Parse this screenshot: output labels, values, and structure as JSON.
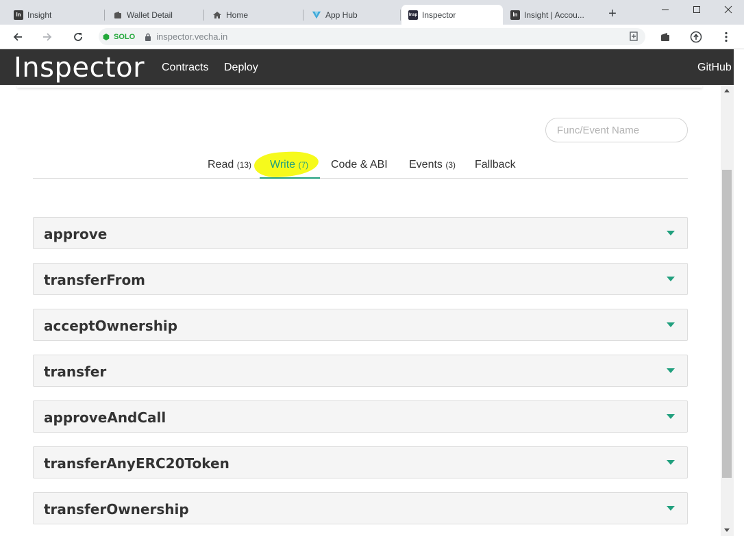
{
  "browser": {
    "tabs": [
      {
        "title": "Insight",
        "icon": "insight-icon"
      },
      {
        "title": "Wallet Detail",
        "icon": "wallet-icon"
      },
      {
        "title": "Home",
        "icon": "home-icon"
      },
      {
        "title": "App Hub",
        "icon": "vechain-icon"
      },
      {
        "title": "Inspector",
        "icon": "inspector-icon",
        "active": true
      },
      {
        "title": "Insight | Accou...",
        "icon": "insight-icon"
      }
    ],
    "network_label": "SOLO",
    "url": "inspector.vecha.in",
    "colors": {
      "network": "#22a83a"
    }
  },
  "header": {
    "brand": "Inspector",
    "nav": [
      "Contracts",
      "Deploy"
    ],
    "github": "GitHub"
  },
  "search": {
    "placeholder": "Func/Event Name"
  },
  "tabs": [
    {
      "label": "Read",
      "count": "(13)"
    },
    {
      "label": "Write",
      "count": "(7)",
      "active": true
    },
    {
      "label": "Code & ABI",
      "count": ""
    },
    {
      "label": "Events",
      "count": "(3)"
    },
    {
      "label": "Fallback",
      "count": ""
    }
  ],
  "functions": [
    "approve",
    "transferFrom",
    "acceptOwnership",
    "transfer",
    "approveAndCall",
    "transferAnyERC20Token",
    "transferOwnership"
  ],
  "colors": {
    "accent": "#21a07e",
    "header_bg": "#333333",
    "highlight": "#f6fa1c"
  }
}
